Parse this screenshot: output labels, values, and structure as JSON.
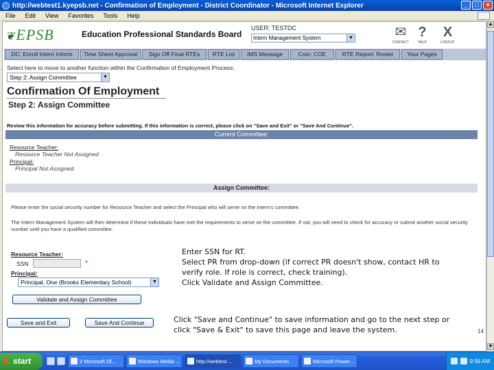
{
  "window": {
    "title": "http://webtest1.kyepsb.net - Confirmation of Employment - District Coordinator - Microsoft Internet Explorer",
    "min": "_",
    "max": "□",
    "close": "×"
  },
  "menu": [
    "File",
    "Edit",
    "View",
    "Favorites",
    "Tools",
    "Help"
  ],
  "header": {
    "logo": "EPSB",
    "org_name": "Education Professional Standards Board",
    "user_label": "USER: TESTDC",
    "system_select": "Intern Management System",
    "icons": [
      {
        "name": "contact-icon",
        "glyph": "✉",
        "label": "CONTACT"
      },
      {
        "name": "help-icon",
        "glyph": "?",
        "label": "HELP"
      },
      {
        "name": "logout-icon",
        "glyph": "X",
        "label": "LOGOUT"
      }
    ]
  },
  "nav_tabs": [
    "DC: Enroll Intern Inform",
    "Time Sheet Approval",
    "Sign Off Final RTEs",
    "RTE List",
    "IMS Message",
    "Coin: COE",
    "RTE Report: Roster",
    "Your Pages"
  ],
  "process": {
    "select_label": "Select here to move to another function within the Confirmation of Employment Process:",
    "step_select": "Step 2: Assign Committee",
    "title": "Confirmation Of Employment",
    "step_title": "Step 2: Assign Committee"
  },
  "review": {
    "text": "Review this information for accuracy before submitting. If this information is correct, please click on \"Save and Exit\" or \"Save And Continue\".",
    "current_bar": "Current Committee:",
    "rt_label": "Resource Teacher:",
    "rt_value": "Resource Teacher Not Assigned",
    "pr_label": "Principal:",
    "pr_value": "Principal Not Assigned."
  },
  "assign": {
    "bar": "Assign Committee:",
    "para1": "Please enter the social security number for Resource Teacher and select the Principal who will serve on the intern's committee.",
    "para2": "The Intern Management System will then determine if these individuals have met the requirements to serve on the committee. If not, you will need to check for accuracy or submit another social security number until you have a qualified committee.",
    "rt_label": "Resource Teacher:",
    "ssn_label": "SSN",
    "ssn_value": "",
    "required": "*",
    "pr_label": "Principal:",
    "pr_select": "Principal, One (Brooks Elementary School)",
    "validate_button": "Validate and Assign Committee",
    "save_exit_button": "Save and Exit",
    "save_continue_button": "Save And Continue"
  },
  "callouts": {
    "upper": [
      "Enter SSN for RT.",
      "Select PR from drop-down (if correct PR doesn't show, contact HR to",
      "verify role.  If role is correct, check training).",
      "Click Validate and Assign Committee."
    ],
    "lower": [
      "Click \"Save and Continue\" to save information and go to the next step or",
      "click \"Save & Exit\" to save this page and leave the system."
    ]
  },
  "page_number": "14",
  "taskbar": {
    "start": "start",
    "tasks": [
      {
        "label": "2 Microsoft Of...",
        "active": false
      },
      {
        "label": "Windows Media ...",
        "active": false
      },
      {
        "label": "http://webtest ...",
        "active": true
      },
      {
        "label": "My Documents",
        "active": false
      },
      {
        "label": "Microsoft Power...",
        "active": false
      }
    ],
    "time": "9:56 AM"
  }
}
